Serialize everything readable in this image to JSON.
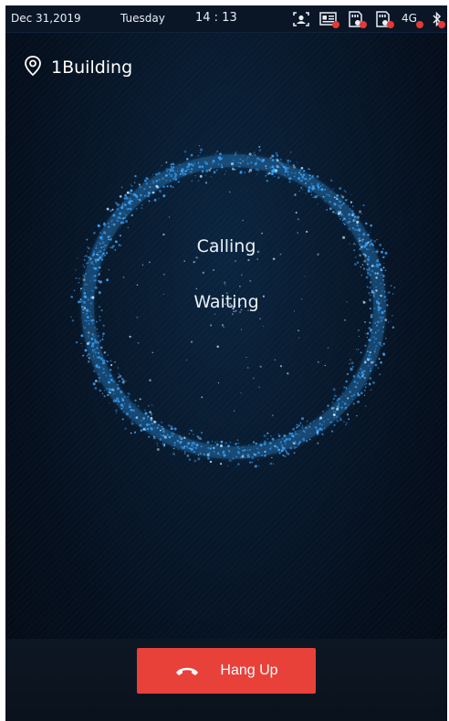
{
  "status_bar": {
    "date": "Dec 31,2019",
    "weekday": "Tuesday",
    "time": "14 : 13",
    "network": "4G",
    "icons": [
      "face-id-icon",
      "card-reader-icon",
      "sd-card-icon",
      "sd-card-icon",
      "4g-network-icon",
      "bluetooth-icon"
    ],
    "error_color": "#e53935"
  },
  "location": {
    "icon": "location-pin-icon",
    "label": "1Building"
  },
  "call": {
    "status": "Calling",
    "substatus": "Waiting",
    "ring_color": "#3aa6ff"
  },
  "actions": {
    "hangup_label": "Hang Up",
    "hangup_icon": "phone-hangup-icon",
    "hangup_color": "#e8413a"
  }
}
